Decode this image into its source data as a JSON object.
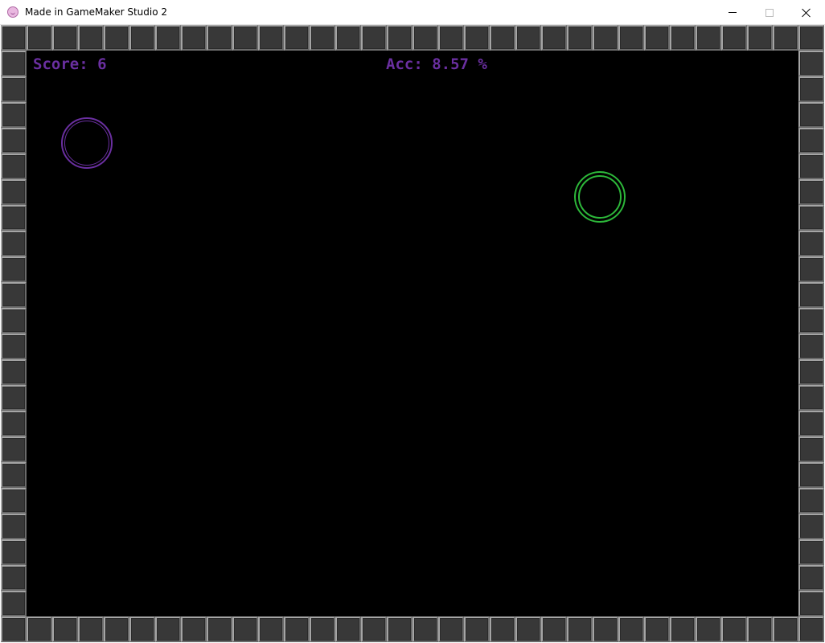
{
  "window": {
    "title": "Made in GameMaker Studio 2",
    "icon": "gamemaker-icon",
    "controls": [
      "minimize-icon",
      "maximize-icon",
      "close-icon"
    ]
  },
  "hud": {
    "score_label": "Score: 6",
    "accuracy_label": "Acc: 8.57 %"
  },
  "colors": {
    "hud_text": "#6a2fa0",
    "background": "#000000",
    "wall_fill": "#383838",
    "wall_edge": "#8a8a8a",
    "target_purple": "#6a2fa0",
    "target_green": "#2db83a"
  },
  "targets": [
    {
      "name": "purple-target",
      "color": "#6a2fa0"
    },
    {
      "name": "green-target",
      "color": "#2db83a"
    }
  ]
}
